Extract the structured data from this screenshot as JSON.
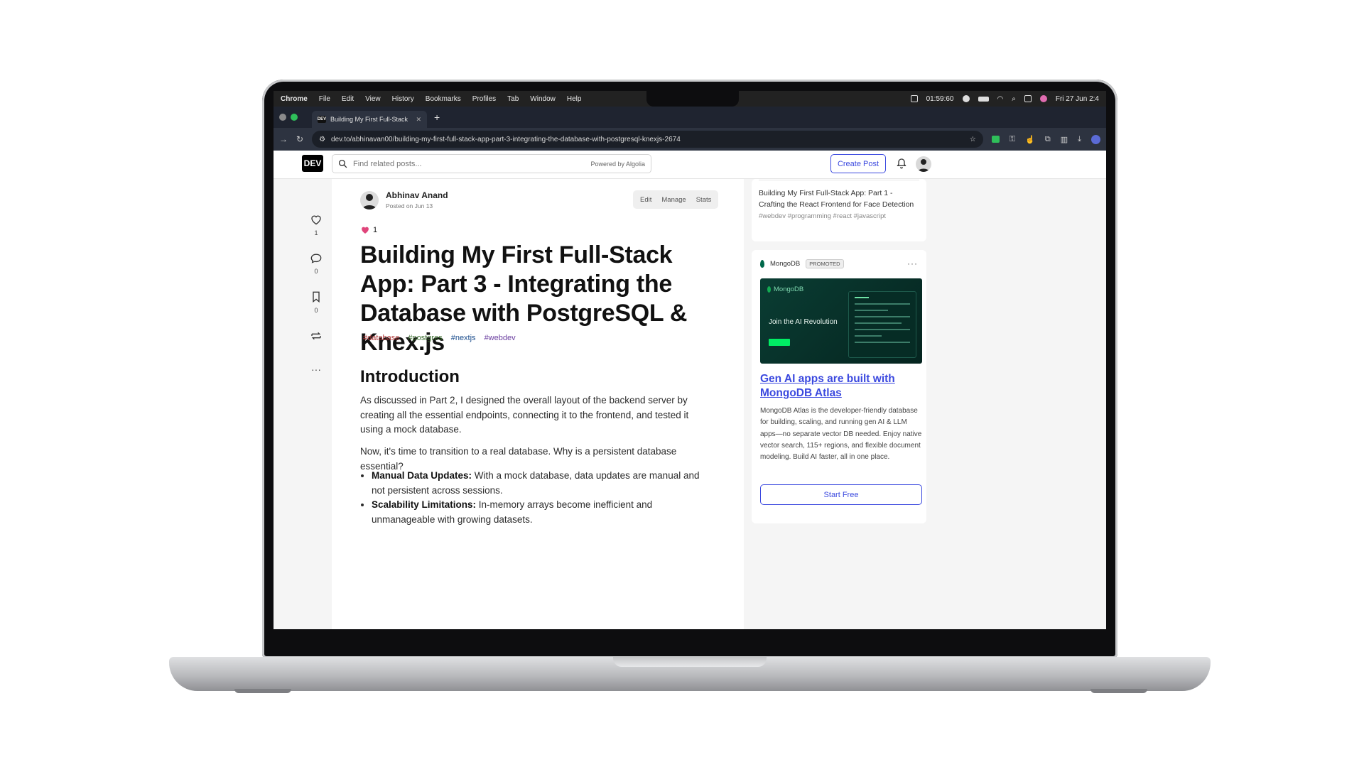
{
  "macos": {
    "app_name": "Chrome",
    "menu": [
      "File",
      "Edit",
      "View",
      "History",
      "Bookmarks",
      "Profiles",
      "Tab",
      "Window",
      "Help"
    ],
    "timer": "01:59:60",
    "datetime": "Fri 27 Jun  2:4"
  },
  "browser": {
    "tab_title": "Building My First Full-Stack",
    "tab_favicon": "DEV",
    "url": "dev.to/abhinavan00/building-my-first-full-stack-app-part-3-integrating-the-database-with-postgresql-knexjs-2674"
  },
  "header": {
    "logo": "DEV",
    "search_placeholder": "Find related posts...",
    "powered_by": "Powered by  Algolia",
    "create_post": "Create Post"
  },
  "rail": {
    "likes": "1",
    "comments": "0",
    "bookmarks": "0"
  },
  "article": {
    "author_name": "Abhinav Anand",
    "posted_on": "Posted on Jun 13",
    "actions": [
      "Edit",
      "Manage",
      "Stats"
    ],
    "reaction_count": "1",
    "title": "Building My First Full-Stack App: Part 3 - Integrating the Database with PostgreSQL & Knex.js",
    "tags": [
      "#database",
      "#postgres",
      "#nextjs",
      "#webdev"
    ],
    "section_title": "Introduction",
    "para1": "As discussed in Part 2, I designed the overall layout of the backend server by creating all the essential endpoints, connecting it to the frontend, and tested it using a mock database.",
    "para2": "Now, it's time to transition to a real database. Why is a persistent database essential?",
    "bullets": [
      {
        "bold": "Manual Data Updates:",
        "text": " With a mock database, data updates are manual and not persistent across sessions."
      },
      {
        "bold": "Scalability Limitations:",
        "text": " In-memory arrays become inefficient and unmanageable with growing datasets."
      }
    ]
  },
  "sidebar": {
    "related_title": "Building My First Full-Stack App: Part 1 - Crafting the React Frontend for Face Detection",
    "related_tags": "#webdev #programming #react #javascript",
    "sponsor_name": "MongoDB",
    "promoted_label": "PROMOTED",
    "banner_brand": "MongoDB",
    "banner_slogan": "Join the AI Revolution",
    "ad_title": "Gen AI apps are built with MongoDB Atlas",
    "ad_text": "MongoDB Atlas is the developer-friendly database for building, scaling, and running gen AI & LLM apps—no separate vector DB needed. Enjoy native vector search, 115+ regions, and flexible document modeling. Build AI faster, all in one place.",
    "cta": "Start Free"
  },
  "colors": {
    "accent": "#3b49df",
    "background": "#f5f5f5",
    "promo_banner": "#0a3d33",
    "mongo_green": "#00ed64"
  },
  "icons": [
    "heart-icon",
    "comment-icon",
    "bookmark-icon",
    "repost-icon",
    "more-icon",
    "search-icon",
    "bell-icon",
    "star-icon",
    "download-icon"
  ]
}
